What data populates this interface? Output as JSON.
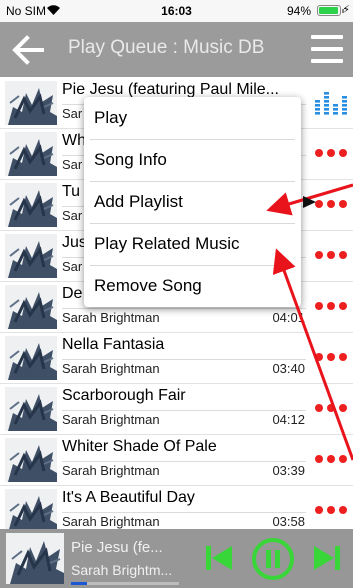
{
  "status_bar": {
    "carrier": "No SIM",
    "time": "16:03",
    "battery": "94%",
    "battery_level": 0.94
  },
  "header": {
    "title": "Play Queue : Music DB"
  },
  "songs": [
    {
      "title": "Pie Jesu (featuring Paul Mile...",
      "artist": "Sar",
      "duration": "",
      "playing": true
    },
    {
      "title": "Wh",
      "artist": "Sar",
      "duration": ""
    },
    {
      "title": "Tu",
      "artist": "Sar",
      "duration": ""
    },
    {
      "title": "Jus",
      "artist": "Sar",
      "duration": ""
    },
    {
      "title": "De",
      "artist": "Sarah Brightman",
      "duration": "04:01"
    },
    {
      "title": "Nella Fantasia",
      "artist": "Sarah Brightman",
      "duration": "03:40"
    },
    {
      "title": "Scarborough Fair",
      "artist": "Sarah Brightman",
      "duration": "04:12"
    },
    {
      "title": "Whiter Shade Of Pale",
      "artist": "Sarah Brightman",
      "duration": "03:39"
    },
    {
      "title": "It's A Beautiful Day",
      "artist": "Sarah Brightman",
      "duration": "03:58"
    }
  ],
  "context_menu": {
    "items": [
      {
        "label": "Play"
      },
      {
        "label": "Song Info"
      },
      {
        "label": "Add Playlist"
      },
      {
        "label": "Play Related Music"
      },
      {
        "label": "Remove Song"
      }
    ]
  },
  "now_playing": {
    "title": "Pie Jesu (fe...",
    "artist": "Sarah Brightm...",
    "progress": 0.15
  },
  "colors": {
    "header_bg": "#9b9b9b",
    "accent_green": "#39d639",
    "more_dots_red": "#ee1f1f",
    "annotation_red": "#e8131b",
    "equalizer_blue": "#2a8fe0",
    "progress_blue": "#1c58d4"
  },
  "icons": {
    "back": "arrow-left-icon",
    "menu": "hamburger-menu-icon",
    "more": "more-dots-icon",
    "playing": "equalizer-icon",
    "previous": "skip-previous-icon",
    "pause": "pause-circle-icon",
    "next": "skip-next-icon"
  }
}
